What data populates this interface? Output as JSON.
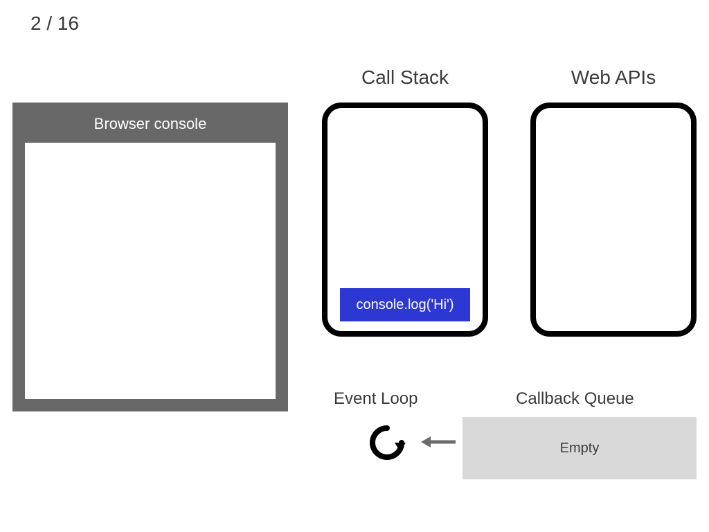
{
  "pager": {
    "text": "2 / 16"
  },
  "console": {
    "title": "Browser console"
  },
  "headings": {
    "callstack": "Call Stack",
    "webapis": "Web APIs",
    "eventloop": "Event Loop",
    "callbackq": "Callback Queue"
  },
  "stack": {
    "item0": "console.log('Hi')"
  },
  "callback_queue": {
    "label": "Empty"
  },
  "colors": {
    "stack_item_bg": "#2c38d1",
    "console_frame": "#686868",
    "queue_bg": "#d9d9d9"
  }
}
